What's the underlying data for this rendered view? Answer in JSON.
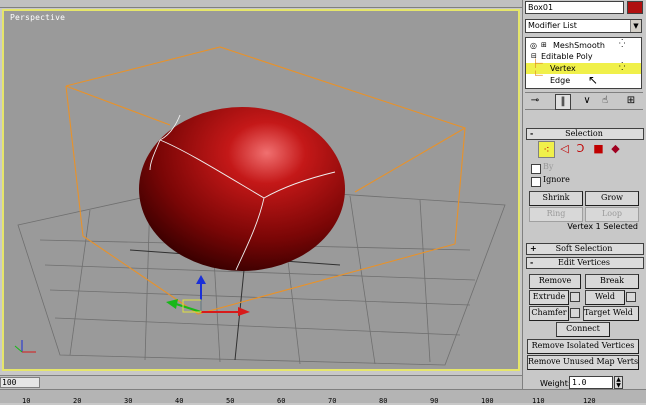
{
  "viewport": {
    "label": "Perspective"
  },
  "time_slider": {
    "value": "100"
  },
  "trackbar": {
    "ticks": [
      "10",
      "20",
      "30",
      "40",
      "50",
      "60",
      "70",
      "80",
      "90",
      "100",
      "110",
      "120"
    ]
  },
  "panel": {
    "object_name": "Box01",
    "object_color": "#b01010",
    "modifier_list": "Modifier List",
    "stack": [
      {
        "label": "MeshSmooth"
      },
      {
        "label": "Editable Poly"
      },
      {
        "label": "Vertex"
      },
      {
        "label": "Edge"
      }
    ],
    "selection": {
      "title": "Selection",
      "by_label": "By",
      "ignore_label": "Ignore",
      "shrink": "Shrink",
      "grow": "Grow",
      "ring": "Ring",
      "loop": "Loop",
      "status": "Vertex 1 Selected"
    },
    "soft_selection": {
      "title": "Soft Selection"
    },
    "edit_vertices": {
      "title": "Edit Vertices",
      "remove": "Remove",
      "break": "Break",
      "extrude": "Extrude",
      "weld": "Weld",
      "chamfer": "Chamfer",
      "target_weld": "Target Weld",
      "connect": "Connect",
      "remove_isolated": "Remove Isolated Vertices",
      "remove_unused_map": "Remove Unused Map Verts",
      "weight_label": "Weight:",
      "weight_value": "1.0"
    }
  }
}
